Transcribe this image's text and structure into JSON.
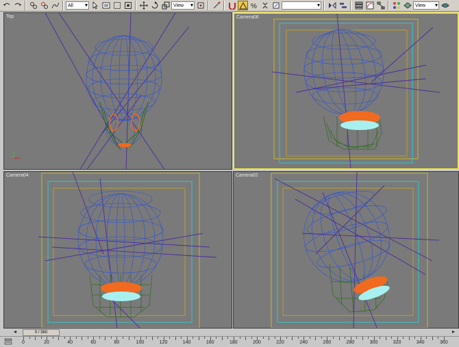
{
  "toolbar": {
    "selection_filter": "All",
    "reference_coord_system": "View",
    "named_selection": "",
    "render_type": "View"
  },
  "viewports": {
    "top": {
      "label": "Top"
    },
    "camera06": {
      "label": "Camera06"
    },
    "camera04": {
      "label": "Camera04"
    },
    "camera02": {
      "label": "Camera02"
    }
  },
  "timeline": {
    "frame_display": "0 / 360",
    "ruler_labels": [
      "0",
      "20",
      "40",
      "60",
      "80",
      "100",
      "120",
      "140",
      "160",
      "180",
      "200",
      "220",
      "240",
      "260",
      "280",
      "300",
      "320",
      "340",
      "360"
    ]
  },
  "colors": {
    "viewport_bg": "#7a7a7a",
    "active_border": "#f0e64a",
    "wire_skull": "#2a52d8",
    "wire_jaw": "#2e6a1a",
    "teeth_orange": "#f06a20",
    "teeth_cyan": "#a8f0f0",
    "safe_frame_cyan": "#30c8c8",
    "safe_frame_yellow": "#c8a820",
    "camera_lines": "#4a2a9a"
  }
}
